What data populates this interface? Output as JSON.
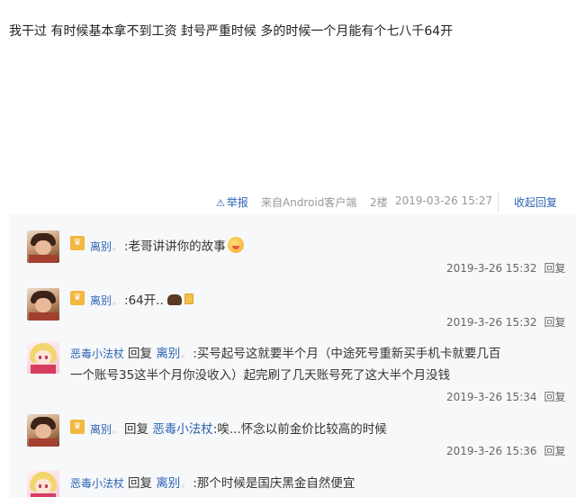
{
  "post": {
    "text": "我干过 有时候基本拿不到工资 封号严重时候 多的时候一个月能有个七八千64开"
  },
  "meta": {
    "report_label": "举报",
    "source": "来自Android客户端",
    "floor": "2楼",
    "datetime": "2019-03-26 15:27",
    "toggle_label": "收起回复"
  },
  "replies": [
    {
      "user": "离别",
      "tag": "。",
      "text": ":老哥讲讲你的故事",
      "emoji": "laughing-face",
      "time": "2019-3-26 15:32",
      "reply_label": "回复"
    },
    {
      "user": "离别",
      "tag": "。",
      "text": ":64开..",
      "emoji": "bear-and-beer",
      "time": "2019-3-26 15:32",
      "reply_label": "回复"
    },
    {
      "user": "恶毒小法杖",
      "tag": "",
      "reply_prefix": "回复",
      "reply_to": "离别",
      "reply_to_tag": "。",
      "text_line1": ":买号起号这就要半个月（中途死号重新买手机卡就要几百",
      "text_line2": "一个账号35这半个月你没收入）起完刷了几天账号死了这大半个月没钱",
      "time": "2019-3-26 15:34",
      "reply_label": "回复"
    },
    {
      "user": "离别",
      "tag": "。",
      "reply_prefix": "回复",
      "reply_to": "恶毒小法杖",
      "text": ":唉...怀念以前金价比较高的时候",
      "time": "2019-3-26 15:36",
      "reply_label": "回复"
    },
    {
      "user": "恶毒小法杖",
      "tag": "",
      "reply_prefix": "回复",
      "reply_to": "离别",
      "reply_to_tag": "。",
      "text": ":那个时候是国庆黑金自然便宜"
    }
  ],
  "badge_icon": "vip-badge-icon",
  "colors": {
    "link": "#2d64b3",
    "panel_bg": "#f7f8fa",
    "badge": "#f4b740"
  }
}
